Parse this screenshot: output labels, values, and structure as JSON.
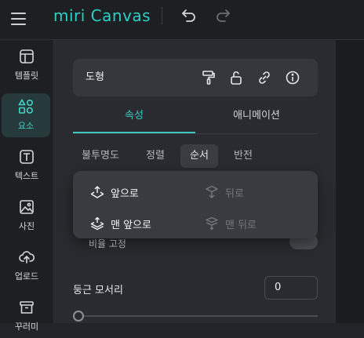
{
  "header": {
    "logo_text": "miri Canvas"
  },
  "sidebar": {
    "items": [
      {
        "label": "템플릿",
        "icon": "template-icon"
      },
      {
        "label": "요소",
        "icon": "elements-icon",
        "active": true
      },
      {
        "label": "텍스트",
        "icon": "text-icon"
      },
      {
        "label": "사진",
        "icon": "photo-icon"
      },
      {
        "label": "업로드",
        "icon": "upload-icon"
      },
      {
        "label": "꾸러미",
        "icon": "archive-icon"
      }
    ]
  },
  "shape_card": {
    "title": "도형",
    "icons": [
      "paint-roller-icon",
      "unlock-icon",
      "link-icon",
      "info-icon"
    ]
  },
  "tabs": [
    {
      "label": "속성",
      "active": true
    },
    {
      "label": "애니메이션",
      "active": false
    }
  ],
  "subtabs": [
    {
      "label": "불투명도"
    },
    {
      "label": "정렬"
    },
    {
      "label": "순서",
      "active": true
    },
    {
      "label": "반전"
    }
  ],
  "order_menu": {
    "bring_forward": "앞으로",
    "send_backward": "뒤로",
    "bring_to_front": "맨 앞으로",
    "send_to_back": "맨 뒤로"
  },
  "lock_row": {
    "label": "비율 고정"
  },
  "corner_radius": {
    "label": "둥근 모서리",
    "value": "0"
  },
  "colors": {
    "accent": "#3cc9bf",
    "panel_bg": "#2a2b30",
    "menu_bg": "#3a3b41"
  }
}
